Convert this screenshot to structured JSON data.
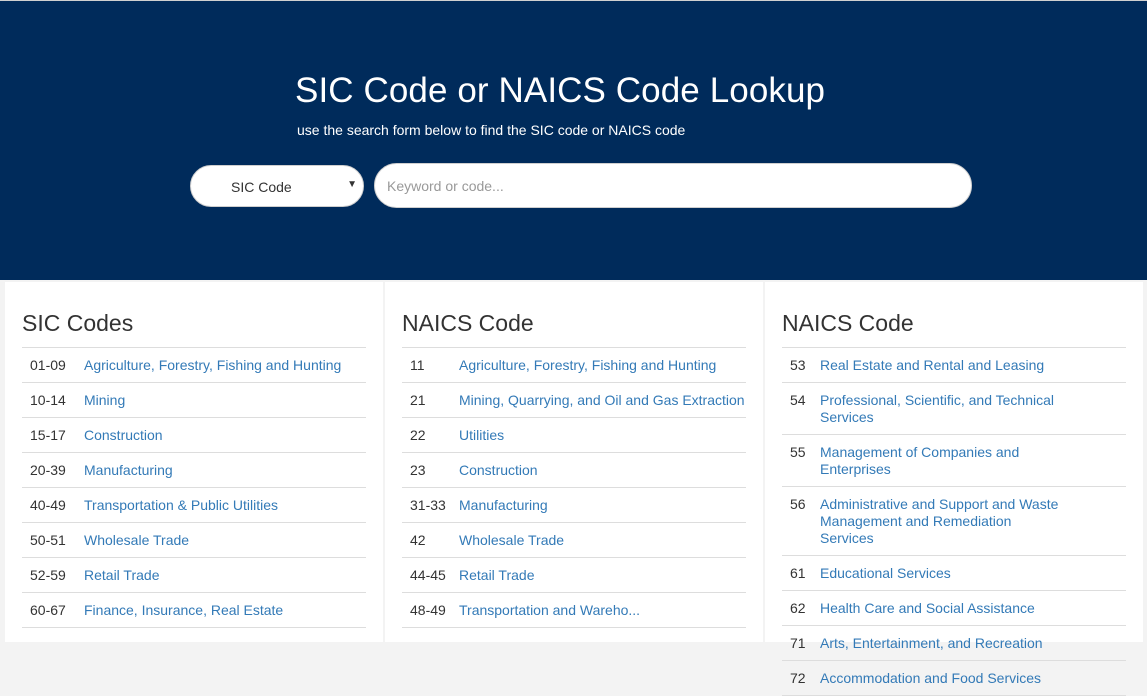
{
  "hero": {
    "title": "SIC Code or NAICS Code Lookup",
    "subtitle": "use the search form below to find the SIC code or NAICS code",
    "select_value": "SIC Code",
    "search_placeholder": "Keyword or code..."
  },
  "colors": {
    "hero_bg": "#002b5b",
    "link": "#337ab7"
  },
  "icons": {
    "select_caret": "chevron-down-icon"
  },
  "columns": [
    {
      "heading": "SIC Codes",
      "rows": [
        {
          "code": "01-09",
          "name": "Agriculture, Forestry, Fishing and Hunting"
        },
        {
          "code": "10-14",
          "name": "Mining"
        },
        {
          "code": "15-17",
          "name": "Construction"
        },
        {
          "code": "20-39",
          "name": "Manufacturing"
        },
        {
          "code": "40-49",
          "name": "Transportation & Public Utilities"
        },
        {
          "code": "50-51",
          "name": "Wholesale Trade"
        },
        {
          "code": "52-59",
          "name": "Retail Trade"
        },
        {
          "code": "60-67",
          "name": "Finance, Insurance, Real Estate"
        }
      ]
    },
    {
      "heading": "NAICS Code",
      "rows": [
        {
          "code": "11",
          "name": "Agriculture, Forestry, Fishing and Hunting"
        },
        {
          "code": "21",
          "name": "Mining, Quarrying, and Oil and Gas Extraction"
        },
        {
          "code": "22",
          "name": "Utilities"
        },
        {
          "code": "23",
          "name": "Construction"
        },
        {
          "code": "31-33",
          "name": "Manufacturing"
        },
        {
          "code": "42",
          "name": "Wholesale Trade"
        },
        {
          "code": "44-45",
          "name": "Retail Trade"
        },
        {
          "code": "48-49",
          "name": "Transportation and Wareho..."
        }
      ]
    },
    {
      "heading": "NAICS Code",
      "rows": [
        {
          "code": "53",
          "name": "Real Estate and Rental and Leasing"
        },
        {
          "code": "54",
          "name": "Professional, Scientific, and Technical Services"
        },
        {
          "code": "55",
          "name": "Management of Companies and Enterprises"
        },
        {
          "code": "56",
          "name": "Administrative and Support and Waste Management and Remediation Services"
        },
        {
          "code": "61",
          "name": "Educational Services"
        },
        {
          "code": "62",
          "name": "Health Care and Social Assistance"
        },
        {
          "code": "71",
          "name": "Arts, Entertainment, and Recreation"
        },
        {
          "code": "72",
          "name": "Accommodation and Food Services"
        }
      ]
    }
  ]
}
